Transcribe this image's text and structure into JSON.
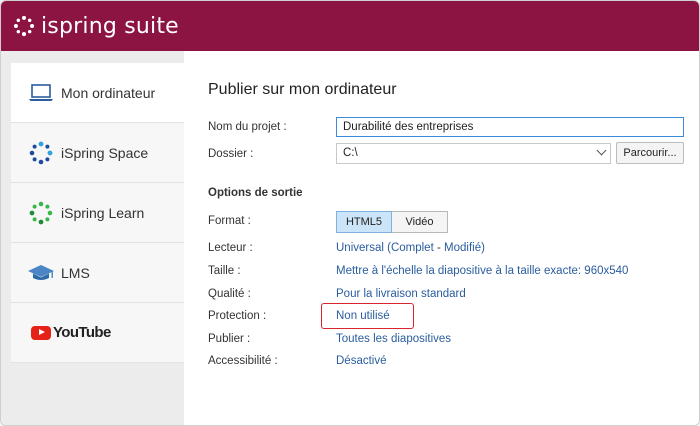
{
  "header": {
    "logo_text": "ispring suite",
    "bg_color": "#8c1443"
  },
  "sidebar": {
    "items": [
      {
        "label": "Mon ordinateur",
        "icon": "laptop-icon",
        "active": true
      },
      {
        "label": "iSpring Space",
        "icon": "ispring-space-icon",
        "active": false
      },
      {
        "label": "iSpring Learn",
        "icon": "ispring-learn-icon",
        "active": false
      },
      {
        "label": "LMS",
        "icon": "graduation-cap-icon",
        "active": false
      },
      {
        "label": "YouTube",
        "icon": "youtube-logo",
        "active": false
      }
    ]
  },
  "main": {
    "title": "Publier sur mon ordinateur",
    "project_name": {
      "label": "Nom du projet :",
      "value": "Durabilité des entreprises"
    },
    "folder": {
      "label": "Dossier :",
      "value": "C:\\",
      "browse_label": "Parcourir..."
    },
    "output_section": "Options de sortie",
    "format": {
      "label": "Format :",
      "options": [
        "HTML5",
        "Vidéo"
      ],
      "selected": "HTML5"
    },
    "player": {
      "label": "Lecteur :",
      "value_main": "Universal (Complet",
      "value_sep": " - ",
      "value_mod": "Modifié)"
    },
    "size": {
      "label": "Taille :",
      "value": "Mettre à l'échelle la diapositive à la taille exacte: 960x540"
    },
    "quality": {
      "label": "Qualité :",
      "value": "Pour la livraison standard"
    },
    "protection": {
      "label": "Protection :",
      "value": "Non utilisé",
      "highlight_color": "#d9262c"
    },
    "publish": {
      "label": "Publier :",
      "value": "Toutes les diapositives"
    },
    "accessibility": {
      "label": "Accessibilité :",
      "value": "Désactivé"
    }
  }
}
